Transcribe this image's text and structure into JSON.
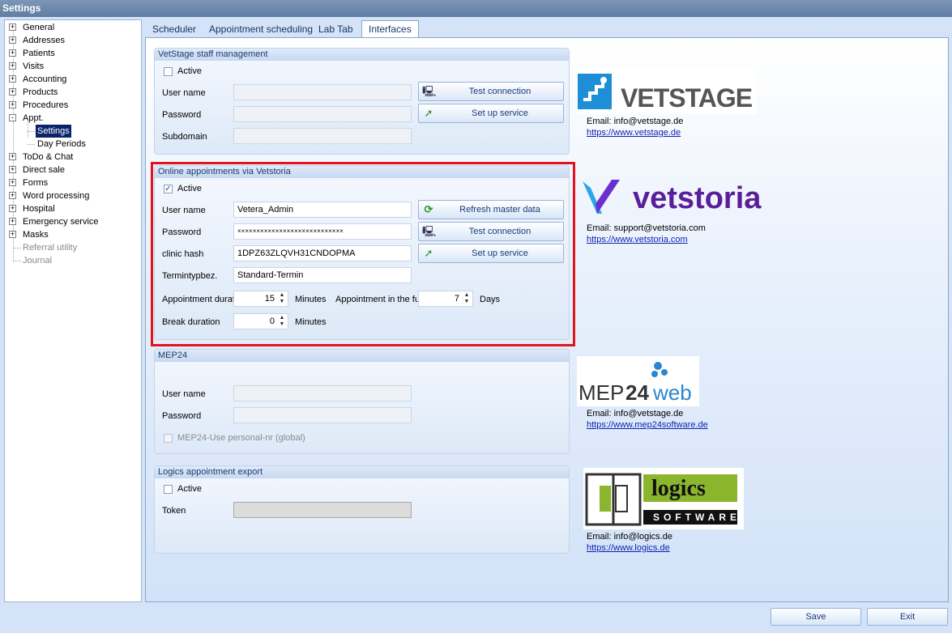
{
  "window": {
    "title": "Settings"
  },
  "tree": {
    "items": [
      {
        "label": "General",
        "expander": "+"
      },
      {
        "label": "Addresses",
        "expander": "+"
      },
      {
        "label": "Patients",
        "expander": "+"
      },
      {
        "label": "Visits",
        "expander": "+"
      },
      {
        "label": "Accounting",
        "expander": "+"
      },
      {
        "label": "Products",
        "expander": "+"
      },
      {
        "label": "Procedures",
        "expander": "+"
      },
      {
        "label": "Appt.",
        "expander": "-"
      },
      {
        "label": "Settings",
        "child": true,
        "selected": true
      },
      {
        "label": "Day Periods",
        "child": true
      },
      {
        "label": "ToDo & Chat",
        "expander": "+"
      },
      {
        "label": "Direct sale",
        "expander": "+"
      },
      {
        "label": "Forms",
        "expander": "+"
      },
      {
        "label": "Word processing",
        "expander": "+"
      },
      {
        "label": "Hospital",
        "expander": "+"
      },
      {
        "label": "Emergency service",
        "expander": "+"
      },
      {
        "label": "Masks",
        "expander": "+"
      },
      {
        "label": "Referral utility",
        "disabled": true
      },
      {
        "label": "Journal",
        "disabled": true
      }
    ]
  },
  "tabs": [
    "Scheduler",
    "Appointment scheduling",
    "Lab Tab",
    "Interfaces"
  ],
  "vetstage": {
    "title": "VetStage staff management",
    "active_label": "Active",
    "username_label": "User name",
    "password_label": "Password",
    "subdomain_label": "Subdomain",
    "test_button": "Test connection",
    "setup_button": "Set up service"
  },
  "vetstoria": {
    "title": "Online appointments via Vetstoria",
    "active_label": "Active",
    "active_checked": "✓",
    "username_label": "User name",
    "username_value": "Vetera_Admin",
    "password_label": "Password",
    "password_value": "××××××××××××××××××××××××××××",
    "clinic_hash_label": "clinic hash",
    "clinic_hash_value": "1DPZ63ZLQVH31CNDOPMA",
    "termintyp_label": "Termintypbez.",
    "termintyp_value": "Standard-Termin",
    "refresh_button": "Refresh master data",
    "test_button": "Test connection",
    "setup_button": "Set up service",
    "duration_label": "Appointment duration",
    "duration_value": "15",
    "duration_unit": "Minutes",
    "future_label": "Appointment in the future",
    "future_value": "7",
    "future_unit": "Days",
    "break_label": "Break duration",
    "break_value": "0",
    "break_unit": "Minutes"
  },
  "mep24": {
    "title": "MEP24",
    "username_label": "User name",
    "password_label": "Password",
    "personal_label": "MEP24-Use personal-nr (global)"
  },
  "logics": {
    "title": "Logics appointment export",
    "active_label": "Active",
    "token_label": "Token"
  },
  "logos": {
    "vetstage": {
      "text": "VETSTAGE",
      "email": "Email: info@vetstage.de",
      "url": "https://www.vetstage.de"
    },
    "vetstoria": {
      "text": "vetstoria",
      "email": "Email: support@vetstoria.com",
      "url": "https://www.vetstoria.com"
    },
    "mep24": {
      "text_a": "MEP",
      "text_b": "24",
      "text_c": "web",
      "email": "Email: info@vetstage.de",
      "url": "https://www.mep24software.de"
    },
    "logics": {
      "text": "logics",
      "subtext": "SOFTWARE",
      "email": "Email: info@logics.de",
      "url": "https://www.logics.de"
    }
  },
  "footer": {
    "save": "Save",
    "exit": "Exit"
  },
  "colors": {
    "highlight": "#e0141e",
    "vetstoria_purple": "#5b1e9a",
    "vetstage_blue": "#1e8fd6",
    "logics_green": "#8cb52e"
  }
}
